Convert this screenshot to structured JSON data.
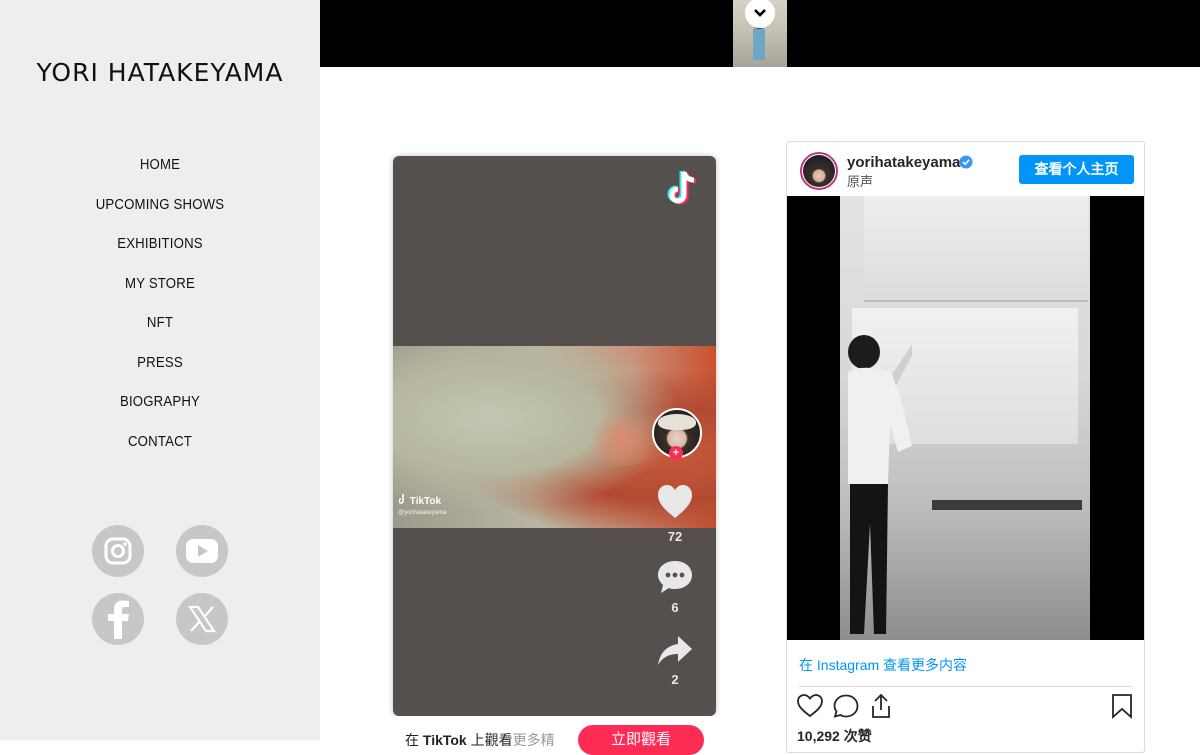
{
  "sidebar": {
    "title": "YORI HATAKEYAMA",
    "nav": [
      "HOME",
      "UPCOMING SHOWS",
      "EXHIBITIONS",
      "MY STORE",
      "NFT",
      "PRESS",
      "BIOGRAPHY",
      "CONTACT"
    ],
    "social": [
      "instagram-icon",
      "youtube-icon",
      "facebook-icon",
      "x-icon"
    ]
  },
  "colors": {
    "sidebar_bg": "#eceeef",
    "social_icon_bg": "#c6c7c9",
    "tiktok_red": "#fe2c55",
    "instagram_blue": "#0095f6"
  },
  "tiktok": {
    "watermark": "TikTok",
    "watermark_user": "@yorihatakeyama",
    "likes": "72",
    "comments": "6",
    "shares": "2",
    "bottom_prefix": "在",
    "bottom_brand": "TikTok",
    "bottom_suffix": "上觀看",
    "bottom_more": "更多精",
    "watch_button": "立即觀看"
  },
  "instagram": {
    "username": "yorihatakeyama",
    "subtitle": "原声",
    "profile_button": "查看个人主页",
    "more_link": "在 Instagram 查看更多内容",
    "likes": "10,292 次赞"
  }
}
